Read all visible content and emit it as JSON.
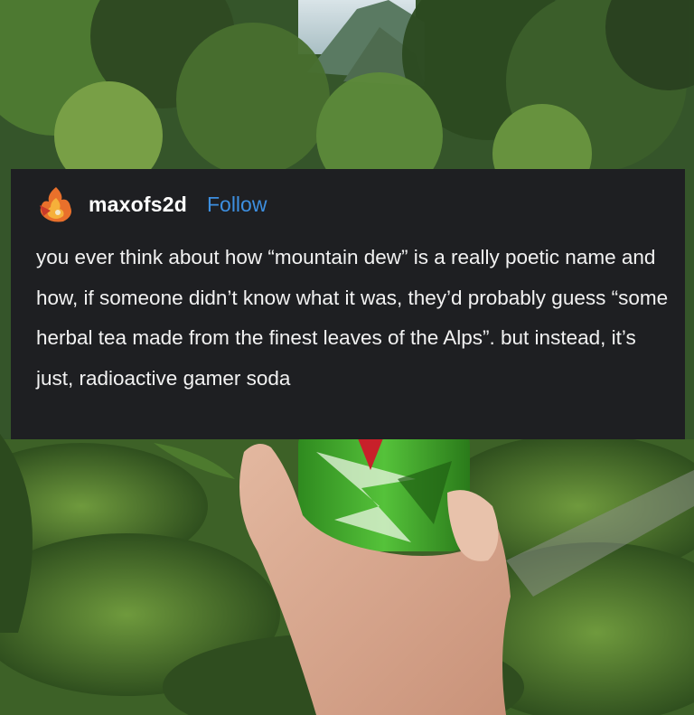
{
  "post": {
    "username": "maxofs2d",
    "follow_label": "Follow",
    "text": "you ever think about how “mountain dew” is a really poetic name and how, if someone didn’t know what it was, they’d probably guess “some herbal tea made from the finest leaves of the Alps”. but instead, it’s just, radioactive gamer soda"
  },
  "colors": {
    "card_background": "#1e1f22",
    "follow_blue": "#3d8fe0",
    "can_green": "#3fa62a",
    "foliage_green": "#3f6a2c"
  },
  "icons": {
    "avatar": "fire-avatar-icon"
  }
}
